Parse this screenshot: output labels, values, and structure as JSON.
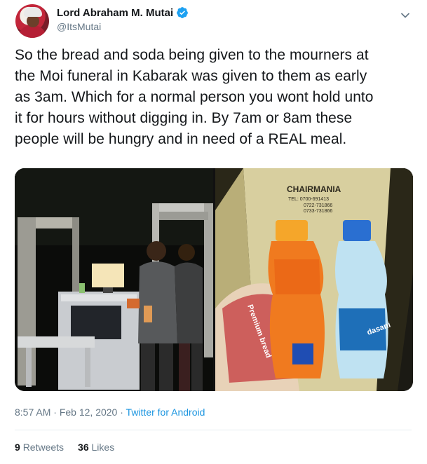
{
  "author": {
    "display_name": "Lord Abraham M. Mutai",
    "handle": "@ItsMutai"
  },
  "tweet": {
    "line1": "So the bread and soda being given to the mourners at",
    "line2": "the Moi funeral in Kabarak was given to them as early",
    "line3": "as 3am. Which for a normal person you wont hold unto",
    "line4": "it for hours without digging in. By 7am or 8am these",
    "line5": "people will be hungry and in need of a REAL meal."
  },
  "media": {
    "right_photo_text": {
      "brand": "CHAIRMANIA",
      "tel1": "TEL: 0700-691413",
      "tel2": "0722-731866",
      "tel3": "0733-731866",
      "wrapper": "Premium bread",
      "water_label": "dasani"
    }
  },
  "meta": {
    "time": "8:57 AM",
    "date": "Feb 12, 2020",
    "source": "Twitter for Android"
  },
  "stats": {
    "retweets_count": "9",
    "retweets_label": "Retweets",
    "likes_count": "36",
    "likes_label": "Likes"
  },
  "colors": {
    "verified": "#1da1f2",
    "link": "#1b95e0",
    "muted": "#657786"
  }
}
